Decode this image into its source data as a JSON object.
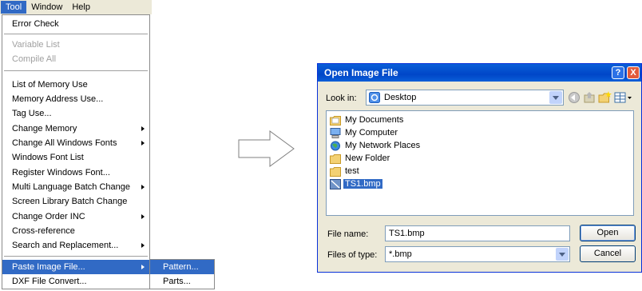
{
  "menubar": {
    "items": [
      "Tool",
      "Window",
      "Help"
    ]
  },
  "tool_menu": {
    "items": [
      {
        "label": "Error Check"
      },
      {
        "label": "Variable List",
        "disabled": true
      },
      {
        "label": "Compile All",
        "disabled": true
      },
      {
        "label": "List of Memory Use"
      },
      {
        "label": "Memory Address Use..."
      },
      {
        "label": "Tag Use..."
      },
      {
        "label": "Change Memory",
        "submenu": true
      },
      {
        "label": "Change All Windows Fonts",
        "submenu": true
      },
      {
        "label": "Windows Font List"
      },
      {
        "label": "Register Windows Font..."
      },
      {
        "label": "Multi Language Batch Change",
        "submenu": true
      },
      {
        "label": "Screen Library Batch Change"
      },
      {
        "label": "Change Order INC",
        "submenu": true
      },
      {
        "label": "Cross-reference"
      },
      {
        "label": "Search and Replacement...",
        "submenu": true
      },
      {
        "label": "Paste Image File...",
        "submenu": true,
        "highlighted": true
      },
      {
        "label": "DXF File Convert..."
      }
    ],
    "submenu": [
      {
        "label": "Pattern...",
        "highlighted": true
      },
      {
        "label": "Parts..."
      }
    ]
  },
  "dialog": {
    "title": "Open Image File",
    "help_label": "?",
    "close_label": "X",
    "look_in_label": "Look in:",
    "look_in_value": "Desktop",
    "files": [
      {
        "name": "My Documents",
        "icon": "my-documents-icon"
      },
      {
        "name": "My Computer",
        "icon": "my-computer-icon"
      },
      {
        "name": "My Network Places",
        "icon": "network-places-icon"
      },
      {
        "name": "New Folder",
        "icon": "folder-icon"
      },
      {
        "name": "test",
        "icon": "folder-icon"
      },
      {
        "name": "TS1.bmp",
        "icon": "bitmap-file-icon",
        "selected": true
      }
    ],
    "file_name_label": "File name:",
    "file_name_value": "TS1.bmp",
    "file_type_label": "Files of type:",
    "file_type_value": "*.bmp",
    "open_label": "Open",
    "cancel_label": "Cancel"
  },
  "colors": {
    "highlight": "#316ac5",
    "titlebar": "#0a5fd8",
    "dialog_bg": "#ece9d8"
  }
}
